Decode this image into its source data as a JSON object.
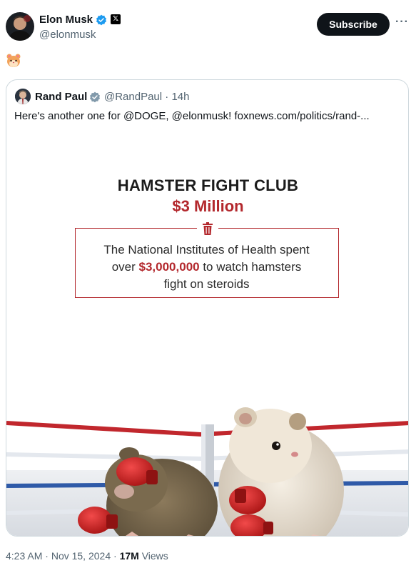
{
  "post": {
    "author_name": "Elon Musk",
    "author_handle": "@elonmusk",
    "subscribe_label": "Subscribe",
    "more_label": "···",
    "body_text": "🐹"
  },
  "quoted": {
    "author_name": "Rand Paul",
    "author_handle": "@RandPaul",
    "separator": "·",
    "age": "14h",
    "text": "Here's another one for @DOGE, @elonmusk! foxnews.com/politics/rand-..."
  },
  "media": {
    "headline": "HAMSTER FIGHT CLUB",
    "amount": "$3 Million",
    "body_line1": "The National Institutes of Health spent",
    "body_line2_pre": "over ",
    "body_line2_strong": "$3,000,000",
    "body_line2_post": " to watch hamsters",
    "body_line3": "fight on steroids"
  },
  "footer": {
    "time": "4:23 AM",
    "separator": "·",
    "date": "Nov 15, 2024",
    "views_count": "17M",
    "views_label": "Views"
  },
  "colors": {
    "accent_red": "#b3282d",
    "verified_blue": "#1d9bf0",
    "verified_gray": "#829aab",
    "text_primary": "#0f1419",
    "text_secondary": "#536471"
  },
  "icons": [
    "verified-badge-icon",
    "x-logo-icon",
    "more-icon",
    "hamster-emoji",
    "trash-icon"
  ]
}
